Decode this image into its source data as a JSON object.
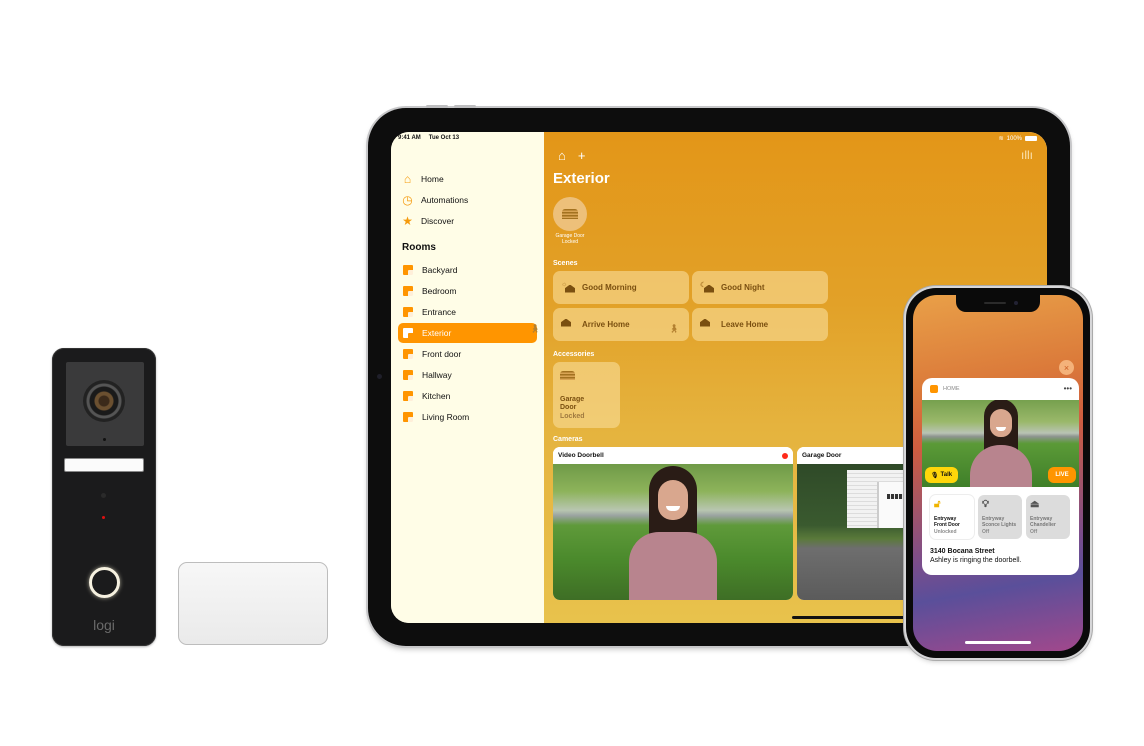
{
  "doorbell": {
    "brand": "logi"
  },
  "ipad": {
    "status": {
      "time": "9:41 AM",
      "date": "Tue Oct 13",
      "battery": "100%"
    },
    "sidebar": {
      "nav": [
        {
          "label": "Home",
          "icon": "house-icon"
        },
        {
          "label": "Automations",
          "icon": "clock-icon"
        },
        {
          "label": "Discover",
          "icon": "star-icon"
        }
      ],
      "rooms_title": "Rooms",
      "rooms": [
        {
          "label": "Backyard",
          "active": false
        },
        {
          "label": "Bedroom",
          "active": false
        },
        {
          "label": "Entrance",
          "active": false
        },
        {
          "label": "Exterior",
          "active": true
        },
        {
          "label": "Front door",
          "active": false
        },
        {
          "label": "Hallway",
          "active": false
        },
        {
          "label": "Kitchen",
          "active": false
        },
        {
          "label": "Living Room",
          "active": false
        }
      ]
    },
    "main": {
      "title": "Exterior",
      "status_tile": {
        "name": "Garage Door",
        "state": "Locked"
      },
      "scenes_label": "Scenes",
      "scenes": [
        {
          "label": "Good Morning",
          "icon": "sun-house-icon"
        },
        {
          "label": "Good Night",
          "icon": "moon-house-icon"
        },
        {
          "label": "Arrive Home",
          "icon": "arrive-home-icon"
        },
        {
          "label": "Leave Home",
          "icon": "leave-home-icon"
        }
      ],
      "accessories_label": "Accessories",
      "accessory": {
        "name_line1": "Garage",
        "name_line2": "Door",
        "state": "Locked"
      },
      "cameras_label": "Cameras",
      "cameras": [
        {
          "label": "Video Doorbell",
          "recording": true
        },
        {
          "label": "Garage Door",
          "recording": false
        }
      ]
    }
  },
  "iphone": {
    "notification": {
      "app": "HOME",
      "more": "•••",
      "talk_label": "Talk",
      "live_label": "LIVE",
      "accessories": [
        {
          "line1": "Entryway",
          "line2": "Front Door",
          "state": "Unlocked",
          "on": true
        },
        {
          "line1": "Entryway",
          "line2": "Sconce Lights",
          "state": "Off",
          "on": false
        },
        {
          "line1": "Entryway",
          "line2": "Chandelier",
          "state": "Off",
          "on": false
        }
      ],
      "title": "3140 Bocana Street",
      "body": "Ashley is ringing the doorbell."
    },
    "close_label": "×"
  },
  "colors": {
    "accent": "#ff9500",
    "sidebar_bg": "#fffde7",
    "record": "#ff2a1a",
    "talk": "#ffd60a"
  }
}
